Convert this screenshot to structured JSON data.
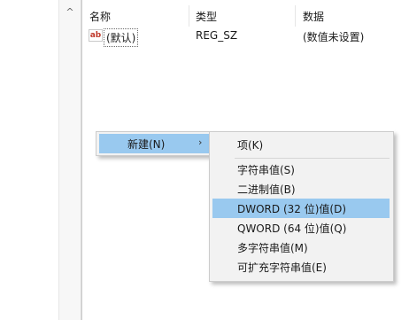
{
  "columns": {
    "name": "名称",
    "type": "类型",
    "data": "数据"
  },
  "value_rows": [
    {
      "icon": "ab",
      "name": "(默认)",
      "type": "REG_SZ",
      "data": "(数值未设置)"
    }
  ],
  "context_menu": {
    "parent_item": {
      "label": "新建(N)",
      "arrow": "›"
    },
    "submenu": {
      "items": [
        {
          "label": "项(K)",
          "highlighted": false
        },
        {
          "label": "字符串值(S)",
          "highlighted": false
        },
        {
          "label": "二进制值(B)",
          "highlighted": false
        },
        {
          "label": "DWORD (32 位)值(D)",
          "highlighted": true
        },
        {
          "label": "QWORD (64 位)值(Q)",
          "highlighted": false
        },
        {
          "label": "多字符串值(M)",
          "highlighted": false
        },
        {
          "label": "可扩充字符串值(E)",
          "highlighted": false
        }
      ]
    }
  },
  "scrollbar": {
    "up_arrow": "^"
  },
  "colors": {
    "highlight": "#99c9ef",
    "menu_bg": "#f2f2f2",
    "icon_text": "#c0392b"
  }
}
